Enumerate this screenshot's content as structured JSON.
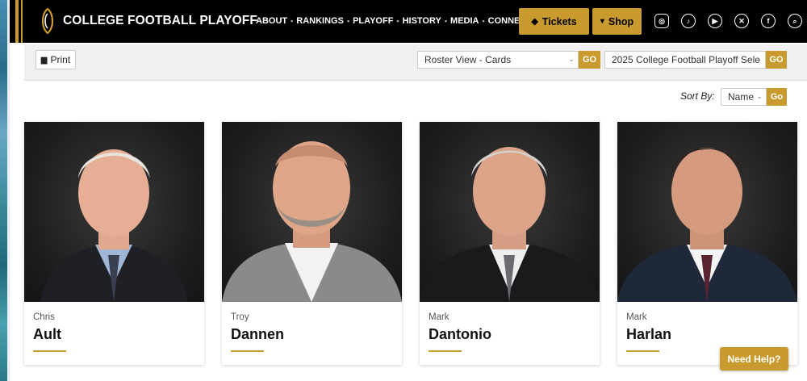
{
  "header": {
    "brand": "COLLEGE FOOTBALL PLAYOFF",
    "nav": [
      "ABOUT",
      "RANKINGS",
      "PLAYOFF",
      "HISTORY",
      "MEDIA",
      "CONNECT"
    ],
    "tickets_label": "Tickets",
    "shop_label": "Shop",
    "social_icons": [
      "instagram-icon",
      "tiktok-icon",
      "youtube-icon",
      "x-icon",
      "facebook-icon",
      "search-icon"
    ]
  },
  "toolbar": {
    "print_label": "Print",
    "roster_view_selected": "Roster View - Cards",
    "season_selected": "2025 College Football Playoff Sele",
    "go_label": "GO"
  },
  "sort": {
    "label": "Sort By:",
    "selected": "Name",
    "go_label": "Go"
  },
  "members": [
    {
      "first": "Chris",
      "last": "Ault"
    },
    {
      "first": "Troy",
      "last": "Dannen"
    },
    {
      "first": "Mark",
      "last": "Dantonio"
    },
    {
      "first": "Mark",
      "last": "Harlan"
    }
  ],
  "help_label": "Need Help?",
  "colors": {
    "accent": "#c99a2e",
    "nav_bg": "#000000",
    "toolbar_bg": "#f0f0f0"
  }
}
